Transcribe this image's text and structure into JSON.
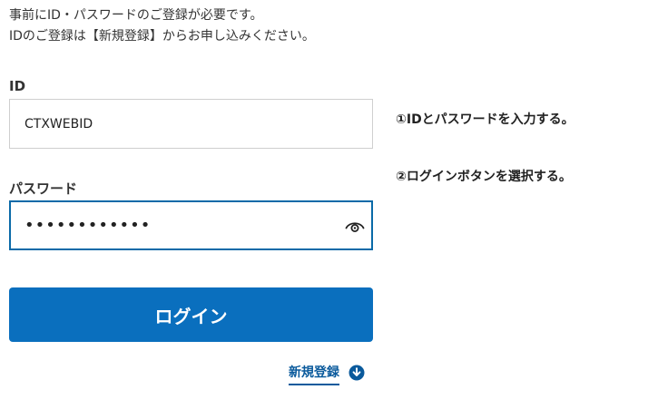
{
  "intro": {
    "line1": "事前にID・パスワードのご登録が必要です。",
    "line2": "IDのご登録は【新規登録】からお申し込みください。"
  },
  "form": {
    "id_label": "ID",
    "id_value": "CTXWEBID",
    "password_label": "パスワード",
    "password_value": "••••••••••••",
    "login_button": "ログイン",
    "register_link": "新規登録"
  },
  "instructions": {
    "step1": "①IDとパスワードを入力する。",
    "step2": "②ログインボタンを選択する。"
  },
  "icons": {
    "password_toggle": "eye-icon",
    "register": "download-circle-icon"
  },
  "colors": {
    "primary_button": "#0a6fbe",
    "focus_border": "#0a6aa8",
    "link": "#0a5a9c"
  }
}
